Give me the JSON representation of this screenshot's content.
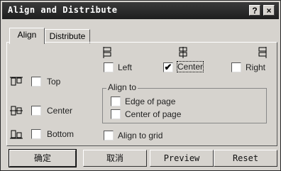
{
  "window": {
    "title": "Align and Distribute",
    "help_label": "?",
    "close_label": "×"
  },
  "tabs": [
    {
      "label": "Align"
    },
    {
      "label": "Distribute"
    }
  ],
  "horizontal": {
    "left_label": "Left",
    "center_label": "Center",
    "right_label": "Right",
    "center_checked": "✔"
  },
  "vertical": {
    "top_label": "Top",
    "center_label": "Center",
    "bottom_label": "Bottom"
  },
  "align_to": {
    "title": "Align to",
    "edge_label": "Edge of page",
    "center_label": "Center of page",
    "grid_label": "Align to grid"
  },
  "buttons": {
    "ok": "确定",
    "cancel": "取消",
    "preview": "Preview",
    "reset": "Reset"
  },
  "icons": [
    "align-left-icon",
    "align-center-icon",
    "align-right-icon",
    "align-top-icon",
    "align-vcenter-icon",
    "align-bottom-icon"
  ]
}
